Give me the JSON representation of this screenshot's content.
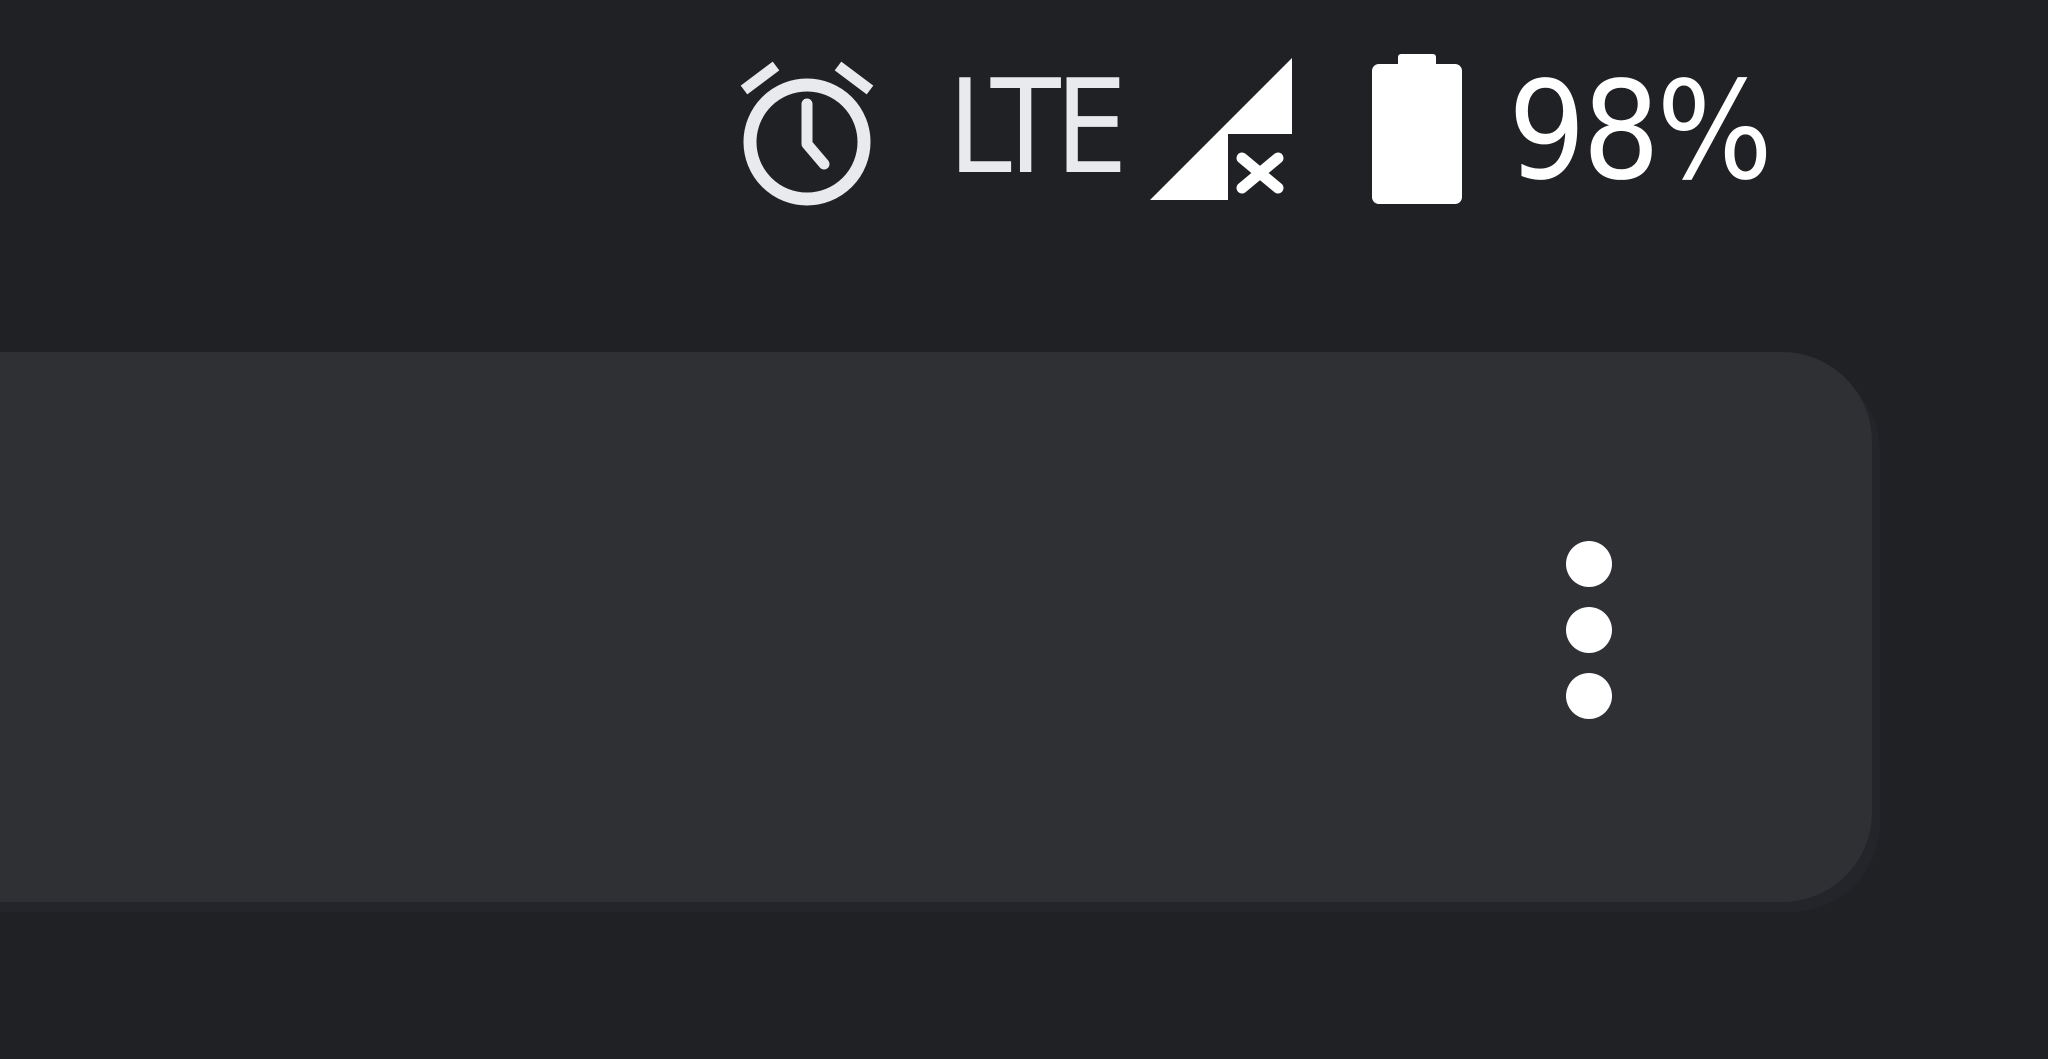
{
  "status_bar": {
    "alarm_icon": "alarm-clock-icon",
    "network_type": "LTE",
    "signal_icon": "cell-signal-no-connection-icon",
    "battery_icon": "battery-icon",
    "battery_level": 0.98,
    "battery_text": "98%"
  },
  "card": {
    "menu_icon": "more-vertical-icon"
  },
  "colors": {
    "background": "#202124",
    "card": "#2f3034",
    "icon": "#e8eaed"
  }
}
